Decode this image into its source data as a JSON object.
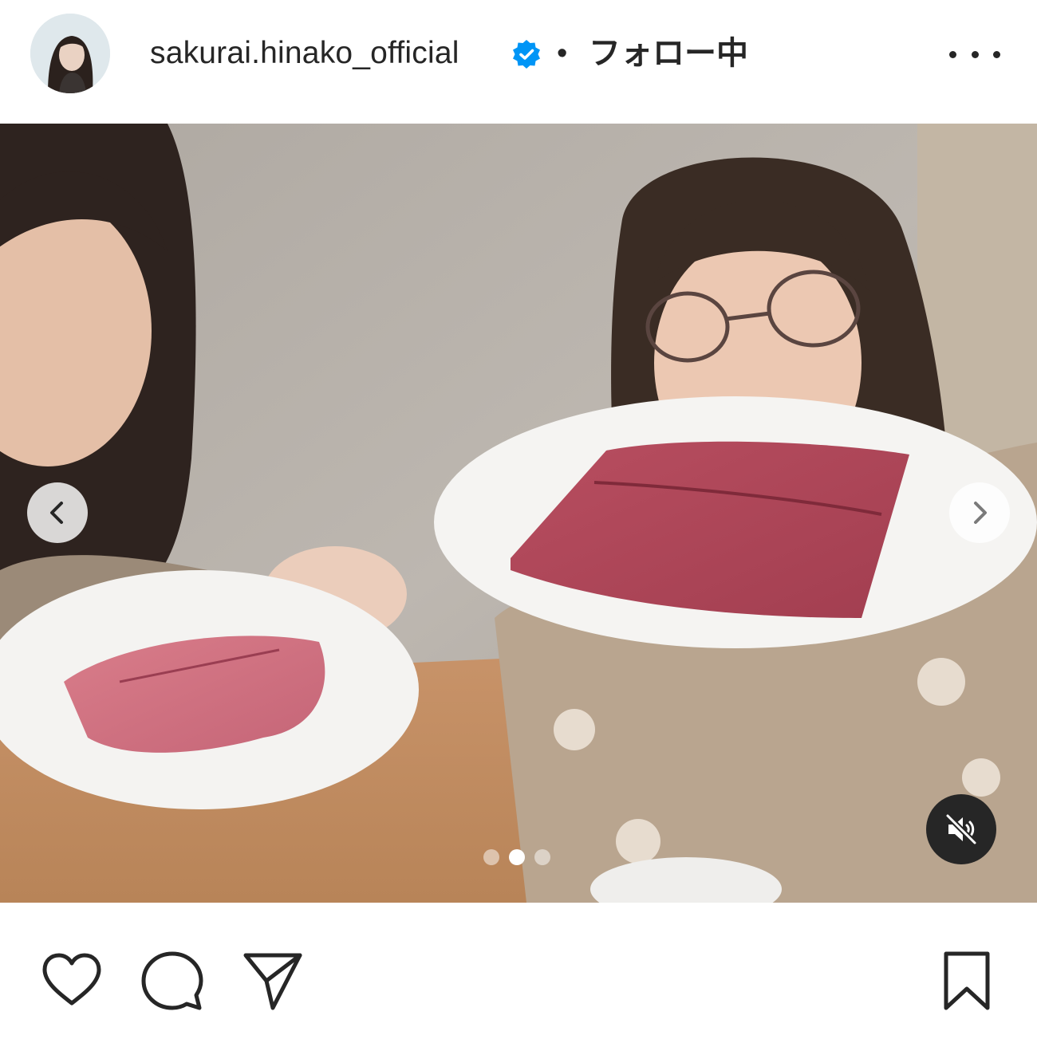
{
  "post": {
    "username": "sakurai.hinako_official",
    "separator": "•",
    "follow_state": "フォロー中",
    "verified": true
  },
  "carousel": {
    "current_slide": 2,
    "total_slides": 3,
    "muted": true
  },
  "icons": {
    "avatar": "avatar",
    "verified": "verified-badge-icon",
    "more": "more-options-icon",
    "prev": "chevron-left-icon",
    "next": "chevron-right-icon",
    "mute": "speaker-muted-icon",
    "like": "heart-icon",
    "comment": "comment-bubble-icon",
    "share": "paper-plane-icon",
    "save": "bookmark-icon"
  },
  "colors": {
    "text": "#262626",
    "verified_blue": "#0095f6",
    "background": "#ffffff"
  }
}
